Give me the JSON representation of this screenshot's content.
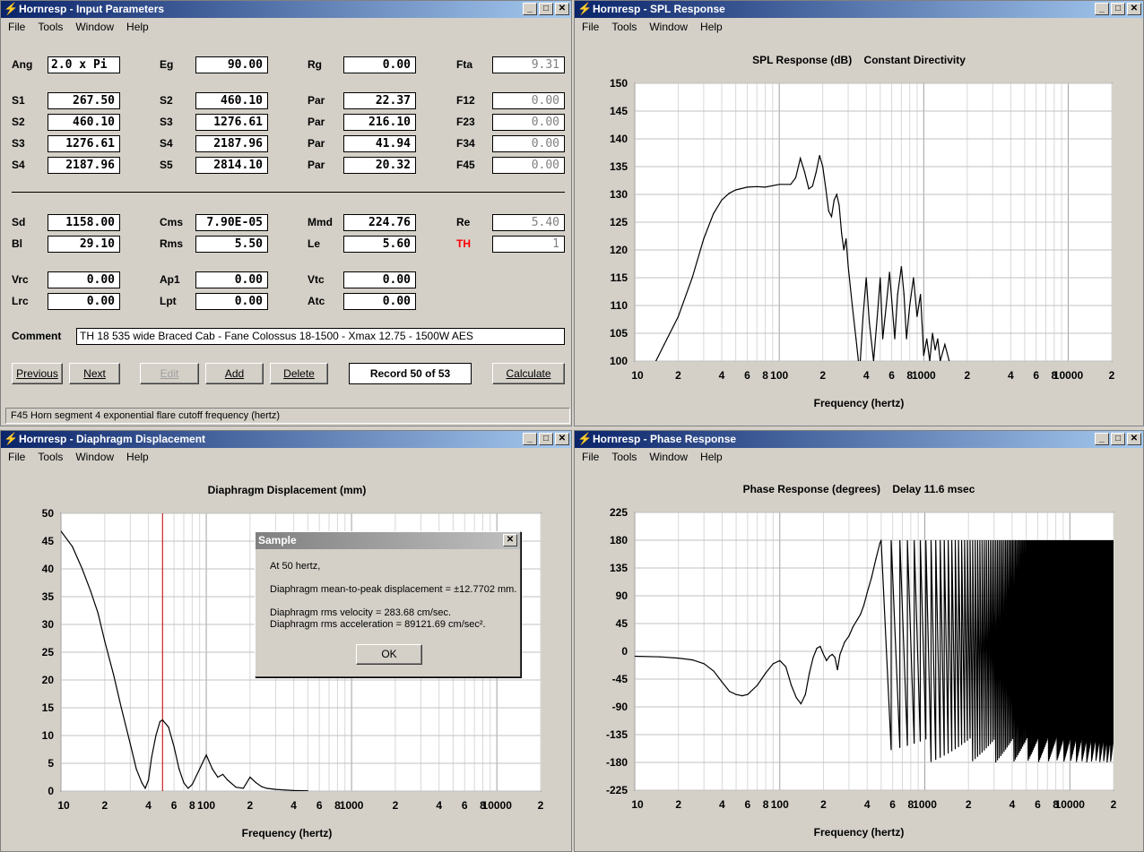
{
  "menu": [
    "File",
    "Tools",
    "Window",
    "Help"
  ],
  "win_input": {
    "title": "Hornresp - Input Parameters",
    "rows1": [
      {
        "l1": "Ang",
        "v1": "2.0 x Pi",
        "l2": "Eg",
        "v2": "90.00",
        "l3": "Rg",
        "v3": "0.00",
        "l4": "Fta",
        "v4": "9.31"
      }
    ],
    "rows2": [
      {
        "l1": "S1",
        "v1": "267.50",
        "l2": "S2",
        "v2": "460.10",
        "l3": "Par",
        "v3": "22.37",
        "l4": "F12",
        "v4": "0.00"
      },
      {
        "l1": "S2",
        "v1": "460.10",
        "l2": "S3",
        "v2": "1276.61",
        "l3": "Par",
        "v3": "216.10",
        "l4": "F23",
        "v4": "0.00"
      },
      {
        "l1": "S3",
        "v1": "1276.61",
        "l2": "S4",
        "v2": "2187.96",
        "l3": "Par",
        "v3": "41.94",
        "l4": "F34",
        "v4": "0.00"
      },
      {
        "l1": "S4",
        "v1": "2187.96",
        "l2": "S5",
        "v2": "2814.10",
        "l3": "Par",
        "v3": "20.32",
        "l4": "F45",
        "v4": "0.00"
      }
    ],
    "rows3": [
      {
        "l1": "Sd",
        "v1": "1158.00",
        "l2": "Cms",
        "v2": "7.90E-05",
        "l3": "Mmd",
        "v3": "224.76",
        "l4": "Re",
        "v4": "5.40"
      },
      {
        "l1": "Bl",
        "v1": "29.10",
        "l2": "Rms",
        "v2": "5.50",
        "l3": "Le",
        "v3": "5.60",
        "l4": "TH",
        "v4": "1"
      }
    ],
    "rows4": [
      {
        "l1": "Vrc",
        "v1": "0.00",
        "l2": "Ap1",
        "v2": "0.00",
        "l3": "Vtc",
        "v3": "0.00"
      },
      {
        "l1": "Lrc",
        "v1": "0.00",
        "l2": "Lpt",
        "v2": "0.00",
        "l3": "Atc",
        "v3": "0.00"
      }
    ],
    "comment_label": "Comment",
    "comment": "TH 18  535 wide Braced Cab - Fane Colossus 18-1500 - Xmax 12.75 - 1500W AES",
    "buttons": {
      "previous": "Previous",
      "next": "Next",
      "edit": "Edit",
      "add": "Add",
      "delete": "Delete",
      "calculate": "Calculate"
    },
    "record": "Record 50 of 53",
    "status": "F45   Horn segment 4 exponential flare cutoff frequency  (hertz)",
    "th_color": "#ff0000"
  },
  "win_spl": {
    "title": "Hornresp - SPL Response",
    "chart_title": "SPL Response (dB)    Constant Directivity",
    "xlabel": "Frequency (hertz)"
  },
  "win_disp": {
    "title": "Hornresp - Diaphragm Displacement",
    "chart_title": "Diaphragm Displacement (mm)",
    "xlabel": "Frequency (hertz)"
  },
  "win_phase": {
    "title": "Hornresp - Phase Response",
    "chart_title": "Phase Response (degrees)    Delay 11.6 msec",
    "xlabel": "Frequency (hertz)"
  },
  "dialog": {
    "title": "Sample",
    "line1": "At 50 hertz,",
    "line2": "Diaphragm mean-to-peak displacement = ±12.7702 mm.",
    "line3": "Diaphragm rms velocity = 283.68 cm/sec.",
    "line4": "Diaphragm rms acceleration = 89121.69 cm/sec².",
    "ok": "OK"
  },
  "x_tick_labels": [
    "10",
    "2",
    "4",
    "6",
    "8",
    "100",
    "2",
    "4",
    "6",
    "8",
    "1000",
    "2",
    "4",
    "6",
    "8",
    "10000",
    "2"
  ],
  "chart_data": [
    {
      "type": "line",
      "title": "SPL Response (dB)    Constant Directivity",
      "xlabel": "Frequency (hertz)",
      "ylabel": "",
      "xscale": "log",
      "xlim": [
        10,
        20000
      ],
      "ylim": [
        100,
        150
      ],
      "yticks": [
        100,
        105,
        110,
        115,
        120,
        125,
        130,
        135,
        140,
        145,
        150
      ],
      "x": [
        10,
        14,
        16,
        20,
        25,
        30,
        35,
        40,
        45,
        50,
        60,
        70,
        80,
        100,
        120,
        130,
        140,
        150,
        160,
        170,
        180,
        190,
        200,
        210,
        220,
        230,
        240,
        250,
        260,
        270,
        280,
        290,
        300,
        320,
        340,
        360,
        380,
        400,
        420,
        450,
        480,
        500,
        520,
        550,
        580,
        600,
        630,
        660,
        700,
        730,
        760,
        800,
        850,
        900,
        950,
        1000,
        1050,
        1100,
        1150,
        1200,
        1250,
        1300,
        1400,
        1500
      ],
      "y": [
        97,
        100,
        103,
        108,
        115,
        122,
        126.5,
        129,
        130.2,
        130.8,
        131.3,
        131.4,
        131.3,
        131.8,
        131.8,
        133,
        136.5,
        134,
        131,
        131.5,
        134,
        137,
        135,
        131,
        127,
        126,
        129,
        130,
        128,
        123,
        120,
        122,
        117,
        110,
        104,
        98,
        108,
        115,
        107,
        100,
        109,
        115,
        104,
        110,
        116,
        111,
        104,
        112,
        117,
        112,
        104,
        110,
        115,
        108,
        112,
        101,
        104,
        100,
        105,
        102,
        104,
        100,
        103,
        100
      ],
      "grid": true
    },
    {
      "type": "line",
      "title": "Diaphragm Displacement (mm)",
      "xlabel": "Frequency (hertz)",
      "ylabel": "",
      "xscale": "log",
      "xlim": [
        10,
        20000
      ],
      "ylim": [
        0,
        50
      ],
      "yticks": [
        0,
        5,
        10,
        15,
        20,
        25,
        30,
        35,
        40,
        45,
        50
      ],
      "x": [
        10,
        12,
        14,
        16,
        18,
        20,
        23,
        26,
        30,
        33,
        36,
        38,
        40,
        42,
        45,
        48,
        50,
        55,
        60,
        65,
        70,
        75,
        80,
        90,
        100,
        110,
        120,
        130,
        140,
        160,
        180,
        200,
        220,
        240,
        260,
        300,
        350,
        400,
        500
      ],
      "y": [
        46.8,
        44,
        40,
        36,
        32,
        27,
        21,
        15,
        8.5,
        4,
        1.5,
        0.5,
        2,
        6,
        10,
        12.5,
        12.8,
        11.5,
        8,
        4,
        1.5,
        0.5,
        1.2,
        4,
        6.5,
        4,
        2.5,
        3,
        2,
        0.7,
        0.5,
        2.5,
        1.5,
        0.8,
        0.5,
        0.3,
        0.2,
        0.1,
        0.05
      ],
      "marker_x": 50,
      "grid": true
    },
    {
      "type": "line",
      "title": "Phase Response (degrees)    Delay 11.6 msec",
      "xlabel": "Frequency (hertz)",
      "ylabel": "",
      "xscale": "log",
      "xlim": [
        10,
        20000
      ],
      "ylim": [
        -225,
        225
      ],
      "yticks": [
        -225,
        -180,
        -135,
        -90,
        -45,
        0,
        45,
        90,
        135,
        180,
        225
      ],
      "x": [
        10,
        15,
        20,
        25,
        30,
        35,
        40,
        45,
        50,
        55,
        60,
        70,
        80,
        90,
        100,
        110,
        120,
        130,
        140,
        150,
        160,
        170,
        180,
        190,
        200,
        210,
        220,
        230,
        240,
        250,
        260,
        280,
        300,
        320,
        340,
        360,
        380,
        400,
        430,
        460,
        490,
        500
      ],
      "y": [
        -8,
        -9,
        -11,
        -14,
        -20,
        -32,
        -50,
        -65,
        -70,
        -72,
        -70,
        -55,
        -35,
        -20,
        -15,
        -25,
        -55,
        -75,
        -85,
        -70,
        -35,
        -10,
        5,
        8,
        -5,
        -15,
        -8,
        -5,
        -10,
        -30,
        -5,
        15,
        25,
        40,
        50,
        60,
        75,
        95,
        120,
        150,
        175,
        180
      ],
      "wrap_start_x": 500,
      "grid": true
    }
  ]
}
